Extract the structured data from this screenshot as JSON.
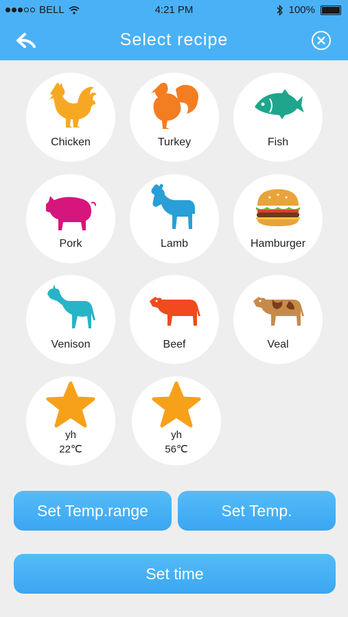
{
  "status": {
    "carrier": "BELL",
    "time": "4:21 PM",
    "battery": "100%",
    "signal_icon": "signal-dots-icon",
    "wifi_icon": "wifi-icon",
    "bluetooth_icon": "bluetooth-icon",
    "battery_icon": "battery-icon"
  },
  "header": {
    "title": "Select recipe",
    "back_icon": "back-arrow-icon",
    "close_icon": "close-circle-icon"
  },
  "recipes": [
    {
      "label": "Chicken",
      "icon": "chicken-icon",
      "color": "#f7a823"
    },
    {
      "label": "Turkey",
      "icon": "turkey-icon",
      "color": "#f47d22"
    },
    {
      "label": "Fish",
      "icon": "fish-icon",
      "color": "#1fa58c"
    },
    {
      "label": "Pork",
      "icon": "pig-icon",
      "color": "#d6157d"
    },
    {
      "label": "Lamb",
      "icon": "goat-icon",
      "color": "#2a9ed6"
    },
    {
      "label": "Hamburger",
      "icon": "hamburger-icon",
      "color": "#e8a33b"
    },
    {
      "label": "Venison",
      "icon": "deer-icon",
      "color": "#27b4c7"
    },
    {
      "label": "Beef",
      "icon": "cow-icon",
      "color": "#f04a1f"
    },
    {
      "label": "Veal",
      "icon": "veal-icon",
      "color": "#b86a2e"
    }
  ],
  "custom_recipes": [
    {
      "name": "yh",
      "temp": "22℃",
      "icon": "star-icon",
      "color": "#f7a11a"
    },
    {
      "name": "yh",
      "temp": "56℃",
      "icon": "star-icon",
      "color": "#f7a11a"
    }
  ],
  "buttons": {
    "temp_range": "Set Temp.range",
    "temp": "Set Temp.",
    "time": "Set time"
  },
  "colors": {
    "accent": "#4ab1f6",
    "background": "#eeeeee"
  }
}
